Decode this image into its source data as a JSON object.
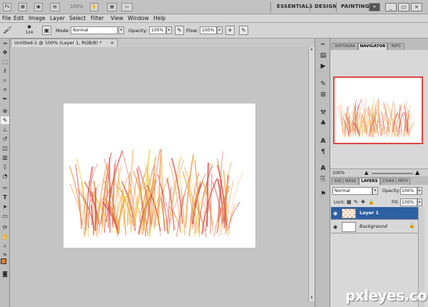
{
  "app_bar": {
    "ps_icon": "Ps",
    "zoom": "100%",
    "workspaces": [
      "ESSENTIALS",
      "DESIGN",
      "PAINTING"
    ],
    "more": "»",
    "min": "_",
    "restore": "▭",
    "close": "×"
  },
  "menu": [
    "File",
    "Edit",
    "Image",
    "Layer",
    "Select",
    "Filter",
    "View",
    "Window",
    "Help"
  ],
  "options": {
    "brush_size": "124",
    "mode_label": "Mode:",
    "mode_value": "Normal",
    "opacity_label": "Opacity:",
    "opacity_value": "100%",
    "flow_label": "Flow:",
    "flow_value": "100%"
  },
  "document": {
    "tab_title": "Untitled-1 @ 100% (Layer 1, RGB/8) *",
    "tab_close": "×"
  },
  "navigator": {
    "tabs": [
      "HISTOGRA",
      "NAVIGATOR",
      "INFO"
    ],
    "zoom": "100%"
  },
  "layers": {
    "tabs": [
      "ADJ | MASK",
      "LAYERS",
      "CHAN | PATH"
    ],
    "blend_mode": "Normal",
    "opacity_label": "Opacity:",
    "opacity_value": "100%",
    "lock_label": "Lock:",
    "fill_label": "Fill:",
    "fill_value": "100%",
    "rows": [
      {
        "name": "Layer 1",
        "selected": true
      },
      {
        "name": "Background",
        "selected": false
      }
    ]
  },
  "watermark": "pxleyes.com",
  "colors": {
    "selected_layer": "#2d5fa3",
    "nav_frame": "#e04545",
    "foreground": "#e87a2a",
    "grass_red": "#d9504a",
    "grass_orange": "#f0a04a",
    "grass_yellow": "#e8d24a"
  }
}
